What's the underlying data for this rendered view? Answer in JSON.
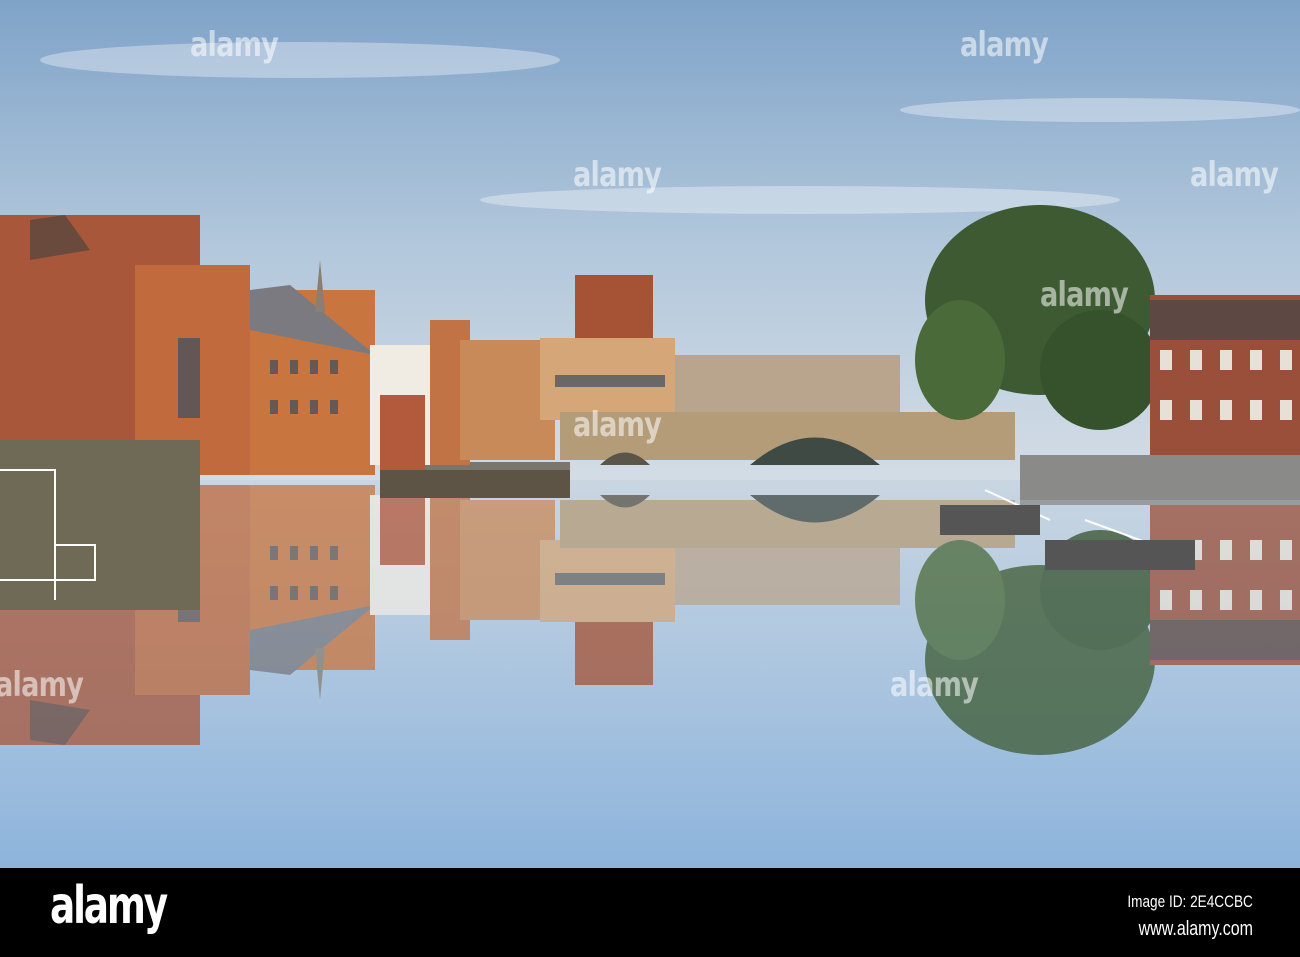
{
  "photo": {
    "subject": "river-city-bridge-scene",
    "sky_color": "#a9c3de",
    "water_color": "#9fbfde",
    "brick_color": "#b4603a"
  },
  "watermark": {
    "text": "alamy"
  },
  "footer": {
    "logo": "alamy",
    "image_id": "Image ID: 2E4CCBC",
    "website": "www.alamy.com"
  }
}
